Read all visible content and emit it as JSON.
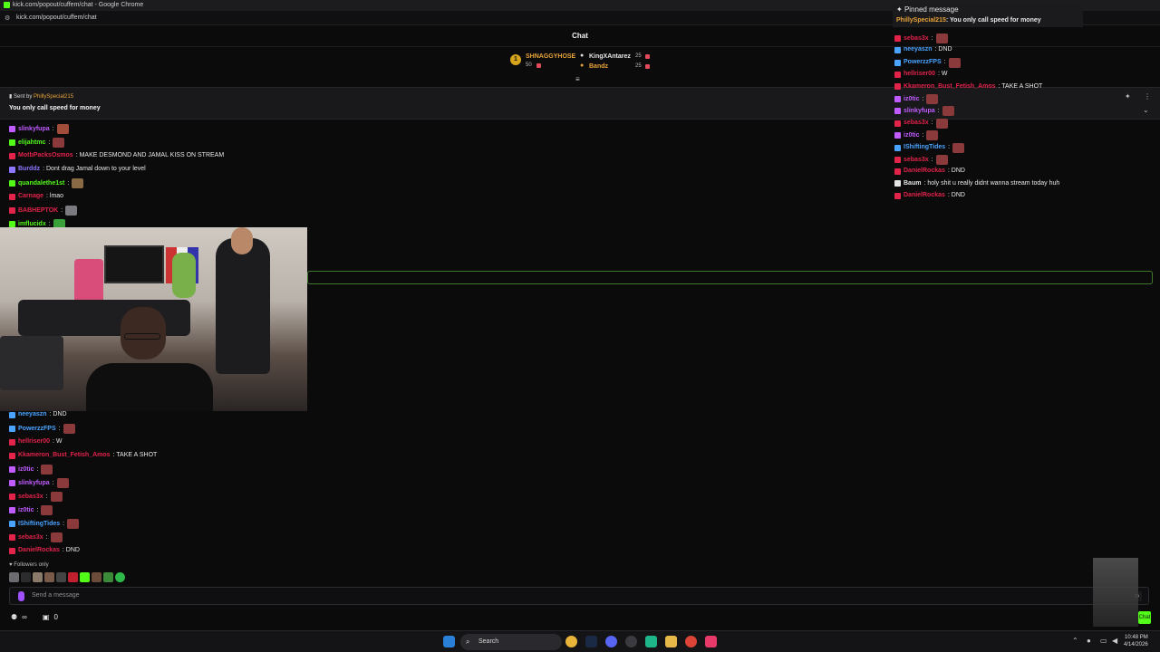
{
  "browser": {
    "window_title": "kick.com/popout/cuffem/chat - Google Chrome",
    "url": "kick.com/popout/cuffem/chat"
  },
  "chat": {
    "title": "Chat",
    "leaderboard": {
      "rank": "1",
      "top": {
        "name": "SHNAGGYHOSE",
        "count": "50"
      },
      "second": {
        "name": "KingXAntarez",
        "count": "25"
      },
      "third": {
        "name": "Bandz",
        "count": "25"
      }
    },
    "pinned": {
      "sent_by_label": "Sent by",
      "sent_by_user": "PhillySpecial215",
      "message": "You only call speed for money"
    },
    "messages_top": [
      {
        "user": "slinkyfupa",
        "text": "",
        "color": "#c05cff",
        "emote": "#a24c3a"
      },
      {
        "user": "elijahtmc",
        "text": "",
        "color": "#53fc18",
        "emote": "#8a3a3a"
      },
      {
        "user": "MotbPacksOsmos",
        "text": ": MAKE DESMOND AND JAMAL KISS ON STREAM",
        "color": "#e2234a",
        "emote": ""
      },
      {
        "user": "Burddz",
        "text": ": Dont drag Jamal down to your level",
        "color": "#8d77ff",
        "emote": ""
      },
      {
        "user": "quandalethe1st",
        "text": "",
        "color": "#53fc18",
        "emote": "#8a6a44"
      },
      {
        "user": "Carnage",
        "text": ": lmao",
        "color": "#e2234a",
        "emote": ""
      },
      {
        "user": "BABHEPTOK",
        "text": "",
        "color": "#e2234a",
        "emote": "#7a7a80"
      },
      {
        "user": "imflucidx",
        "text": "",
        "color": "#53fc18",
        "emote": "#3aa03a"
      }
    ],
    "messages_bottom": [
      {
        "user": "neeyaszn",
        "text": ": DND",
        "color": "#4aa3ff"
      },
      {
        "user": "PowerzzFPS",
        "text": "",
        "color": "#4aa3ff"
      },
      {
        "user": "hellriser00",
        "text": ": W",
        "color": "#e2234a"
      },
      {
        "user": "Kkameron_Bust_Fetish_Amos",
        "text": ": TAKE A SHOT",
        "color": "#e2234a"
      },
      {
        "user": "iz0tic",
        "text": "",
        "color": "#c05cff"
      },
      {
        "user": "slinkyfupa",
        "text": "",
        "color": "#c05cff"
      },
      {
        "user": "sebas3x",
        "text": "",
        "color": "#e2234a"
      },
      {
        "user": "iz0tic",
        "text": "",
        "color": "#c05cff"
      },
      {
        "user": "IShiftingTides",
        "text": "",
        "color": "#4aa3ff"
      },
      {
        "user": "sebas3x",
        "text": "",
        "color": "#e2234a"
      },
      {
        "user": "DanielRockas",
        "text": ": DND",
        "color": "#e2234a"
      }
    ],
    "followers_only": "Followers only",
    "input_placeholder": "Send a message",
    "footer_count": "0",
    "footer_infinity": "∞"
  },
  "overlay": {
    "pinned_label": "Pinned message",
    "pinned_user": "PhillySpecial215",
    "pinned_text": ": You only call speed for money",
    "messages": [
      {
        "user": "sebas3x",
        "text": "",
        "color": "#e2234a"
      },
      {
        "user": "neeyaszn",
        "text": ": DND",
        "color": "#4aa3ff"
      },
      {
        "user": "PowerzzFPS",
        "text": "",
        "color": "#4aa3ff"
      },
      {
        "user": "hellriser00",
        "text": ": W",
        "color": "#e2234a"
      },
      {
        "user": "Kkameron_Bust_Fetish_Amos",
        "text": ": TAKE A SHOT",
        "color": "#e2234a"
      },
      {
        "user": "iz0tic",
        "text": "",
        "color": "#c05cff"
      },
      {
        "user": "slinkyfupa",
        "text": "",
        "color": "#c05cff"
      },
      {
        "user": "sebas3x",
        "text": "",
        "color": "#e2234a"
      },
      {
        "user": "iz0tic",
        "text": "",
        "color": "#c05cff"
      },
      {
        "user": "IShiftingTides",
        "text": "",
        "color": "#4aa3ff"
      },
      {
        "user": "sebas3x",
        "text": "",
        "color": "#e2234a"
      },
      {
        "user": "DanielRockas",
        "text": ": DND",
        "color": "#e2234a"
      },
      {
        "user": "Baum",
        "text": ": holy shit u really didnt wanna stream today huh",
        "color": "#e6e6e6"
      },
      {
        "user": "DanielRockas",
        "text": ": DND",
        "color": "#e2234a"
      }
    ]
  },
  "taskbar": {
    "search_label": "Search",
    "time": "10:48 PM",
    "date": "4/14/2026"
  },
  "colors": {
    "kick_green": "#53fc18",
    "background": "#0b0b0c"
  }
}
